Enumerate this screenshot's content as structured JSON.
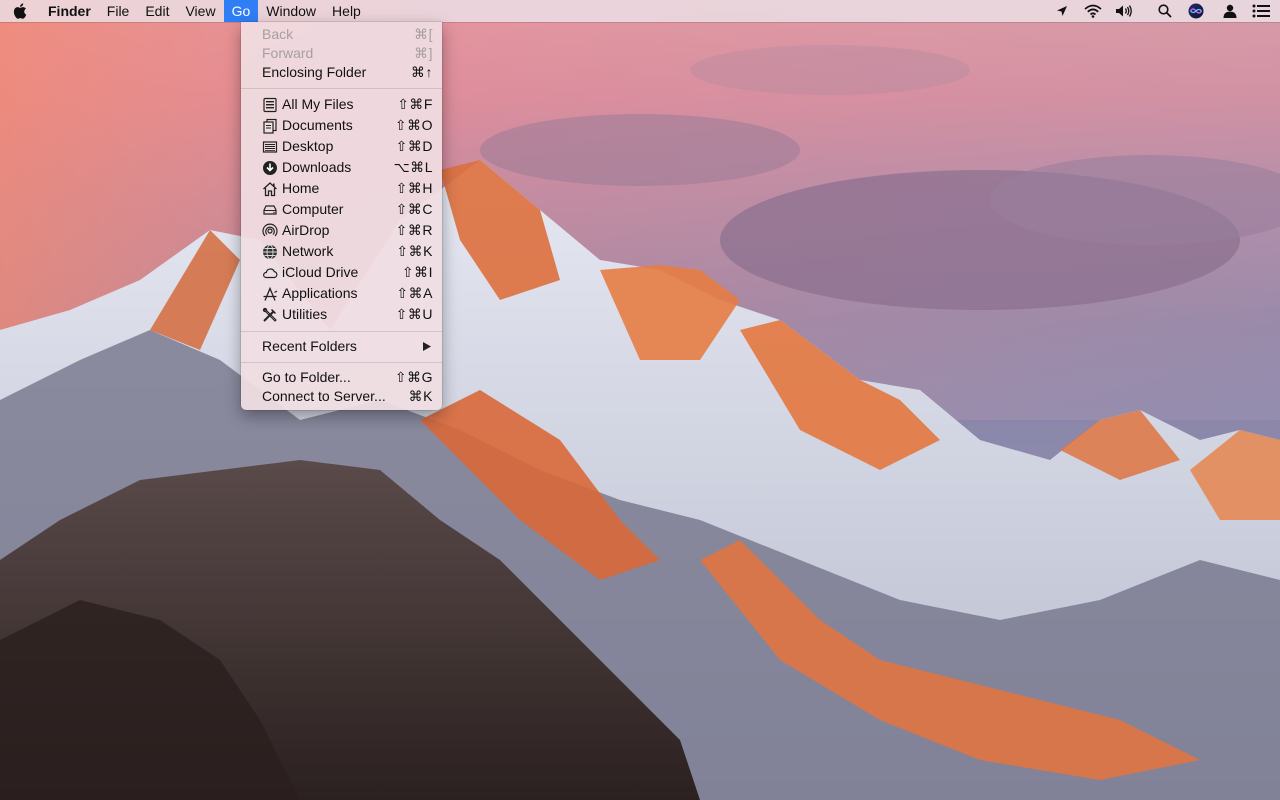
{
  "menubar": {
    "app_name": "Finder",
    "menus": [
      "File",
      "Edit",
      "View",
      "Go",
      "Window",
      "Help"
    ],
    "active_menu": "Go"
  },
  "status_icons": [
    "location-icon",
    "wifi-icon",
    "volume-icon",
    "spotlight-icon",
    "siri-icon",
    "user-icon",
    "notification-center-icon"
  ],
  "go_menu": {
    "back": {
      "label": "Back",
      "shortcut": "⌘[",
      "enabled": false
    },
    "forward": {
      "label": "Forward",
      "shortcut": "⌘]",
      "enabled": false
    },
    "enclosing": {
      "label": "Enclosing Folder",
      "shortcut": "⌘↑"
    },
    "places": [
      {
        "label": "All My Files",
        "shortcut": "⇧⌘F",
        "icon": "all-my-files-icon"
      },
      {
        "label": "Documents",
        "shortcut": "⇧⌘O",
        "icon": "documents-icon"
      },
      {
        "label": "Desktop",
        "shortcut": "⇧⌘D",
        "icon": "desktop-icon"
      },
      {
        "label": "Downloads",
        "shortcut": "⌥⌘L",
        "icon": "downloads-icon"
      },
      {
        "label": "Home",
        "shortcut": "⇧⌘H",
        "icon": "home-icon"
      },
      {
        "label": "Computer",
        "shortcut": "⇧⌘C",
        "icon": "computer-icon"
      },
      {
        "label": "AirDrop",
        "shortcut": "⇧⌘R",
        "icon": "airdrop-icon"
      },
      {
        "label": "Network",
        "shortcut": "⇧⌘K",
        "icon": "network-icon"
      },
      {
        "label": "iCloud Drive",
        "shortcut": "⇧⌘I",
        "icon": "icloud-drive-icon"
      },
      {
        "label": "Applications",
        "shortcut": "⇧⌘A",
        "icon": "applications-icon"
      },
      {
        "label": "Utilities",
        "shortcut": "⇧⌘U",
        "icon": "utilities-icon"
      }
    ],
    "recent_folders": {
      "label": "Recent Folders"
    },
    "go_to_folder": {
      "label": "Go to Folder...",
      "shortcut": "⇧⌘G"
    },
    "connect_to_server": {
      "label": "Connect to Server...",
      "shortcut": "⌘K"
    }
  },
  "colors": {
    "menu_highlight": "#2f7ef6",
    "disabled_text": "#a69ea1"
  }
}
